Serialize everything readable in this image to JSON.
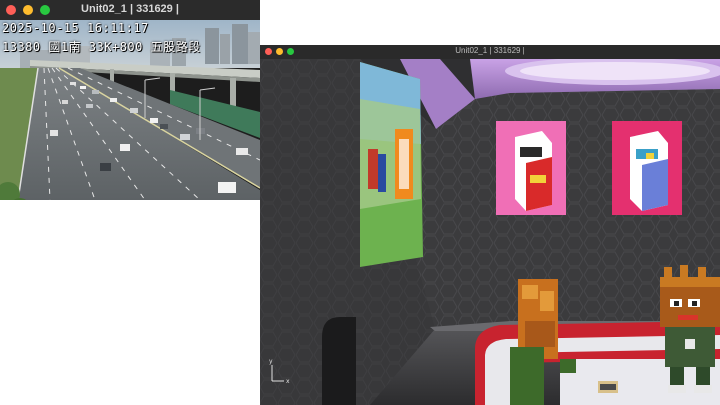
{
  "windows": [
    {
      "title": "Unit02_1 | 331629 |",
      "camera_feed": {
        "timestamp": "2025-10-15 16:11:17",
        "location": "13380 國1南 33K+800 五股路段"
      }
    },
    {
      "title": "Unit02_1 | 331629 |",
      "scene": {
        "axis_gizmo": {
          "y_label": "y",
          "x_label": "x"
        }
      }
    }
  ],
  "colors": {
    "close": "#ff5f57",
    "minimize": "#febc2e",
    "zoom": "#28c840",
    "room_wall": "#3a3a3c",
    "ceiling": "#b98fd8",
    "poster_pink": "#f06fb6",
    "poster_red": "#e4306f",
    "seat_red": "#c8232f"
  }
}
